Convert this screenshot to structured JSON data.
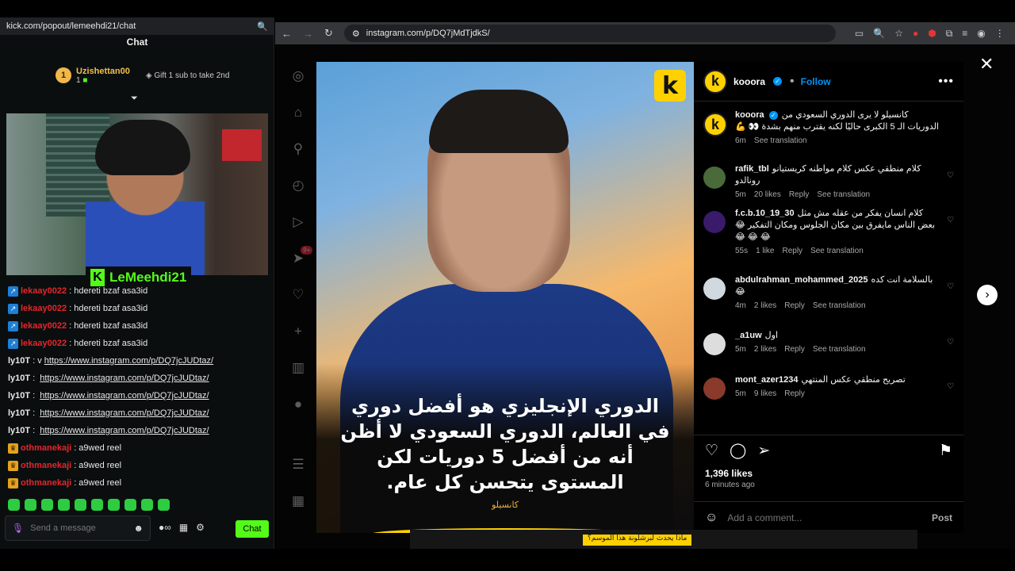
{
  "kick": {
    "url": "kick.com/popout/lemeehdi21/chat",
    "zoom_icon": "zoom-icon",
    "title": "Chat",
    "leaderboard": {
      "rank": "1",
      "user": "Uzishettan00",
      "count": "1",
      "gift": "Gift 1 sub to take 2nd"
    },
    "streamer": "LeMeehdi21",
    "messages": [
      {
        "user": "lekaay0022",
        "color": "#e4262b",
        "badge": "blue",
        "text": ": hdereti bzaf asa3id"
      },
      {
        "user": "lekaay0022",
        "color": "#e4262b",
        "badge": "blue",
        "text": ": hdereti bzaf asa3id"
      },
      {
        "user": "lekaay0022",
        "color": "#e4262b",
        "badge": "blue",
        "text": ": hdereti bzaf asa3id"
      },
      {
        "user": "lekaay0022",
        "color": "#e4262b",
        "badge": "blue",
        "text": ": hdereti bzaf asa3id"
      },
      {
        "user": "ly10T",
        "color": "#e8e8e8",
        "badge": "",
        "prefix": ": v",
        "link": "https://www.instagram.com/p/DQ7jcJUDtaz/"
      },
      {
        "user": "ly10T",
        "color": "#e8e8e8",
        "badge": "",
        "prefix": ": ",
        "link": "https://www.instagram.com/p/DQ7jcJUDtaz/"
      },
      {
        "user": "ly10T",
        "color": "#e8e8e8",
        "badge": "",
        "prefix": ": ",
        "link": "https://www.instagram.com/p/DQ7jcJUDtaz/"
      },
      {
        "user": "ly10T",
        "color": "#e8e8e8",
        "badge": "",
        "prefix": ": ",
        "link": "https://www.instagram.com/p/DQ7jcJUDtaz/"
      },
      {
        "user": "ly10T",
        "color": "#e8e8e8",
        "badge": "",
        "prefix": ": ",
        "link": "https://www.instagram.com/p/DQ7jcJUDtaz/"
      },
      {
        "user": "othmanekaji",
        "color": "#e4262b",
        "badge": "gold",
        "text": ": a9wed reel"
      },
      {
        "user": "othmanekaji",
        "color": "#e4262b",
        "badge": "gold",
        "text": ": a9wed reel"
      },
      {
        "user": "othmanekaji",
        "color": "#e4262b",
        "badge": "gold",
        "text": ": a9wed reel"
      }
    ],
    "input_placeholder": "Send a message",
    "send_label": "Chat",
    "accent": "#53fc18"
  },
  "browser": {
    "url": "instagram.com/p/DQ7jMdTjdkS/"
  },
  "post": {
    "headline": "الدوري الإنجليزي هو أفضل دوري في العالم، الدوري السعودي لا أظن أنه من أفضل 5 دوريات لكن المستوى يتحسن كل عام.",
    "source": "كانسيلو",
    "account": "kooora",
    "follow_label": "Follow",
    "caption": "كانسيلو لا يرى الدوري السعودي من الدوريات الـ 5 الكبرى حاليًا لكنه يقترب منهم بشدة 👀 💪",
    "caption_time": "6m",
    "see_translation": "See translation",
    "comments": [
      {
        "user": "rafik_tbl",
        "text": "كلام منطقي عكس كلام مواطنه كريستيانو رونالدو",
        "time": "5m",
        "likes": "20 likes",
        "reply": "Reply",
        "translate": "See translation",
        "avatar_color": "#4a6a3a"
      },
      {
        "user": "f.c.b.10_19_30",
        "text": "كلام انسان يفكر من عقله مش مثل بعض الناس مايفرق بين مكان الجلوس ومكان التفكير 😂 😂 😂 😂",
        "time": "55s",
        "likes": "1 like",
        "reply": "Reply",
        "translate": "See translation",
        "avatar_color": "#3a1a6a"
      },
      {
        "user": "abdulrahman_mohammed_2025",
        "text": "بالسلامة انت كده 😂",
        "time": "4m",
        "likes": "2 likes",
        "reply": "Reply",
        "translate": "See translation",
        "avatar_color": "#d0d8e0"
      },
      {
        "user": "_a1uw",
        "text": "اول",
        "time": "5m",
        "likes": "2 likes",
        "reply": "Reply",
        "translate": "See translation",
        "avatar_color": "#dddddd"
      },
      {
        "user": "mont_azer1234",
        "text": "تصريح منطقي عكس المنتهي",
        "time": "5m",
        "likes": "9 likes",
        "reply": "Reply",
        "translate": "",
        "avatar_color": "#8a3a2a"
      }
    ],
    "likes_count": "1,396 likes",
    "posted": "6 minutes ago",
    "add_comment_placeholder": "Add a comment...",
    "post_label": "Post",
    "below_tag": "ماذا يحدث لبرشلونة هذا الموسم؟"
  }
}
